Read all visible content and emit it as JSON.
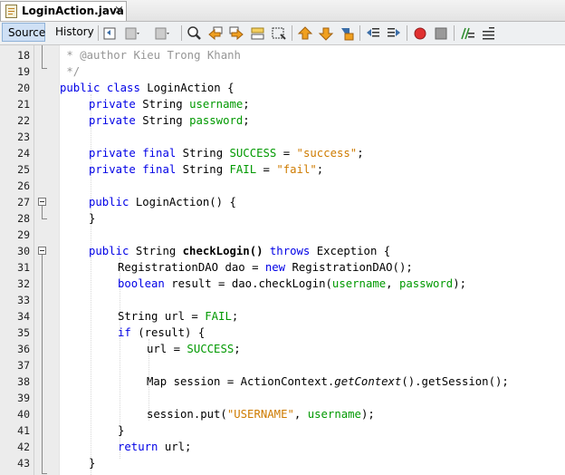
{
  "editor_tab": {
    "title": "LoginAction.java",
    "close_glyph": "×",
    "icon": "java-file-icon"
  },
  "toolbar": {
    "source_label": "Source",
    "history_label": "History",
    "icons": [
      "last-edit-icon",
      "back-icon",
      "forward-icon",
      "find-icon",
      "find-previous-icon",
      "find-next-icon",
      "toggle-highlight-icon",
      "find-selection-icon",
      "previous-bookmark-icon",
      "next-bookmark-icon",
      "toggle-bookmark-icon",
      "shift-left-icon",
      "shift-right-icon",
      "start-macro-icon",
      "stop-macro-icon",
      "comment-icon",
      "uncomment-icon"
    ]
  },
  "line_numbers": [
    "18",
    "19",
    "20",
    "21",
    "22",
    "23",
    "24",
    "25",
    "26",
    "27",
    "28",
    "29",
    "30",
    "31",
    "32",
    "33",
    "34",
    "35",
    "36",
    "37",
    "38",
    "39",
    "40",
    "41",
    "42",
    "43"
  ],
  "code": {
    "l18": {
      "star": " * ",
      "tag": "@author",
      "text": " Kieu Trong Khanh"
    },
    "l19": {
      "text": " */"
    },
    "l20": {
      "kw1": "public",
      "kw2": "class",
      "name": "LoginAction {"
    },
    "l21": {
      "kw": "private",
      "type": "String",
      "field": "username",
      "end": ";"
    },
    "l22": {
      "kw": "private",
      "type": "String",
      "field": "password",
      "end": ";"
    },
    "l24": {
      "kw1": "private",
      "kw2": "final",
      "type": "String",
      "field": "SUCCESS",
      "eq": " = ",
      "str": "\"success\"",
      "end": ";"
    },
    "l25": {
      "kw1": "private",
      "kw2": "final",
      "type": "String",
      "field": "FAIL",
      "eq": " = ",
      "str": "\"fail\"",
      "end": ";"
    },
    "l27": {
      "kw": "public",
      "sig": "LoginAction() {"
    },
    "l28": {
      "text": "}"
    },
    "l30": {
      "kw": "public",
      "type": "String",
      "method": "checkLogin()",
      "throws": "throws",
      "exc": "Exception {"
    },
    "l31": {
      "pre": "RegistrationDAO dao = ",
      "kw": "new",
      "post": " RegistrationDAO();"
    },
    "l32": {
      "kw": "boolean",
      "pre": " result = dao.checkLogin(",
      "f1": "username",
      "mid": ", ",
      "f2": "password",
      "end": ");"
    },
    "l34": {
      "pre": "String url = ",
      "field": "FAIL",
      "end": ";"
    },
    "l35": {
      "kw": "if",
      "rest": " (result) {"
    },
    "l36": {
      "pre": "url = ",
      "field": "SUCCESS",
      "end": ";"
    },
    "l38": {
      "pre": "Map session = ActionContext.",
      "it": "getContext",
      "post": "().getSession();"
    },
    "l40": {
      "pre": "session.put(",
      "str": "\"USERNAME\"",
      "mid": ", ",
      "field": "username",
      "end": ");"
    },
    "l41": {
      "text": "}"
    },
    "l42": {
      "kw": "return",
      "rest": " url;"
    },
    "l43": {
      "text": "}"
    }
  }
}
